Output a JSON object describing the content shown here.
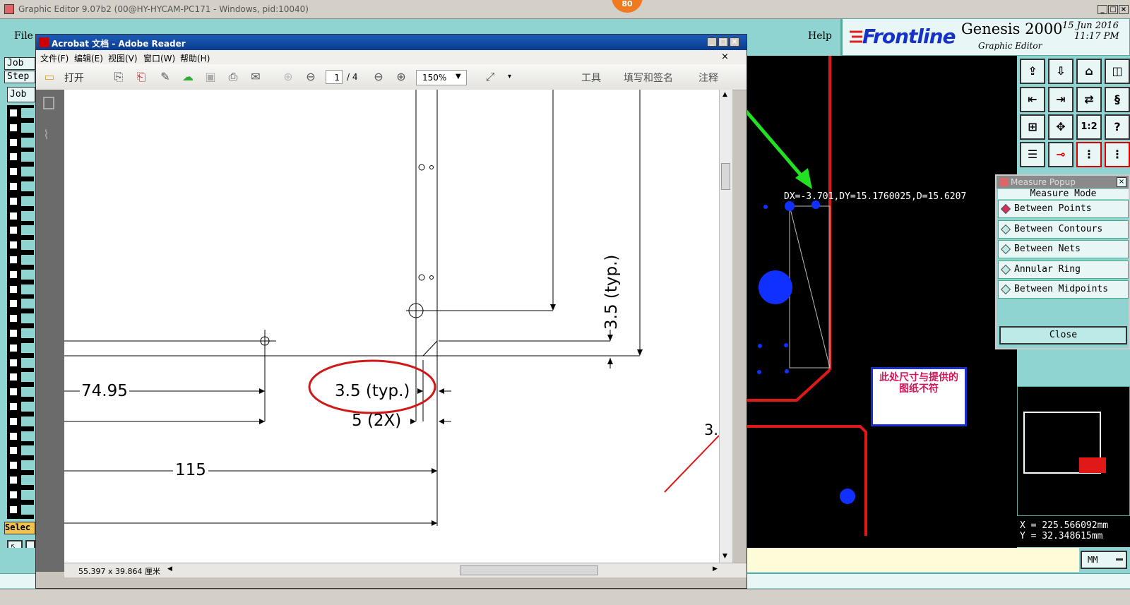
{
  "genesis": {
    "window_title": "Graphic Editor 9.07b2 (00@HY-HYCAM-PC171 - Windows, pid:10040)",
    "badge": "80",
    "menu_file": "File",
    "menu_help": "Help",
    "brand": "Frontline",
    "product": "Genesis 2000",
    "subtitle": "Graphic Editor",
    "date": "15 Jun 2016",
    "time": "11:17 PM",
    "left_labels": [
      "Job",
      "Step",
      "Job"
    ],
    "select_label": "Selec",
    "measure_text": "DX=-3.701,DY=15.1760025,D=15.6207",
    "note_text": "此处尺寸与提供的图纸不符",
    "cad_fragment": "3.",
    "coords": {
      "x": "X = 225.566092mm",
      "y": "Y = 32.348615mm"
    },
    "units": "MM"
  },
  "measure_popup": {
    "title": "Measure Popup",
    "mode_label": "Measure Mode",
    "options": [
      "Between Points",
      "Between Contours",
      "Between Nets",
      "Annular Ring",
      "Between Midpoints"
    ],
    "selected": "Between Points",
    "close_label": "Close"
  },
  "acrobat": {
    "title": "Acrobat 文档 - Adobe Reader",
    "menu": [
      "文件(F)",
      "编辑(E)",
      "视图(V)",
      "窗口(W)",
      "帮助(H)"
    ],
    "open_label": "打开",
    "page_current": "1",
    "page_total": "/ 4",
    "zoom": "150%",
    "tools": "工具",
    "sign": "填写和签名",
    "comment": "注释",
    "page_size": "55.397 x 39.864 厘米"
  },
  "drawing": {
    "dim_74": "74.95",
    "dim_typ_h": "3.5 (typ.)",
    "dim_2x": "5 (2X)",
    "dim_115": "115",
    "dim_typ_v": "3.5 (typ.)"
  }
}
